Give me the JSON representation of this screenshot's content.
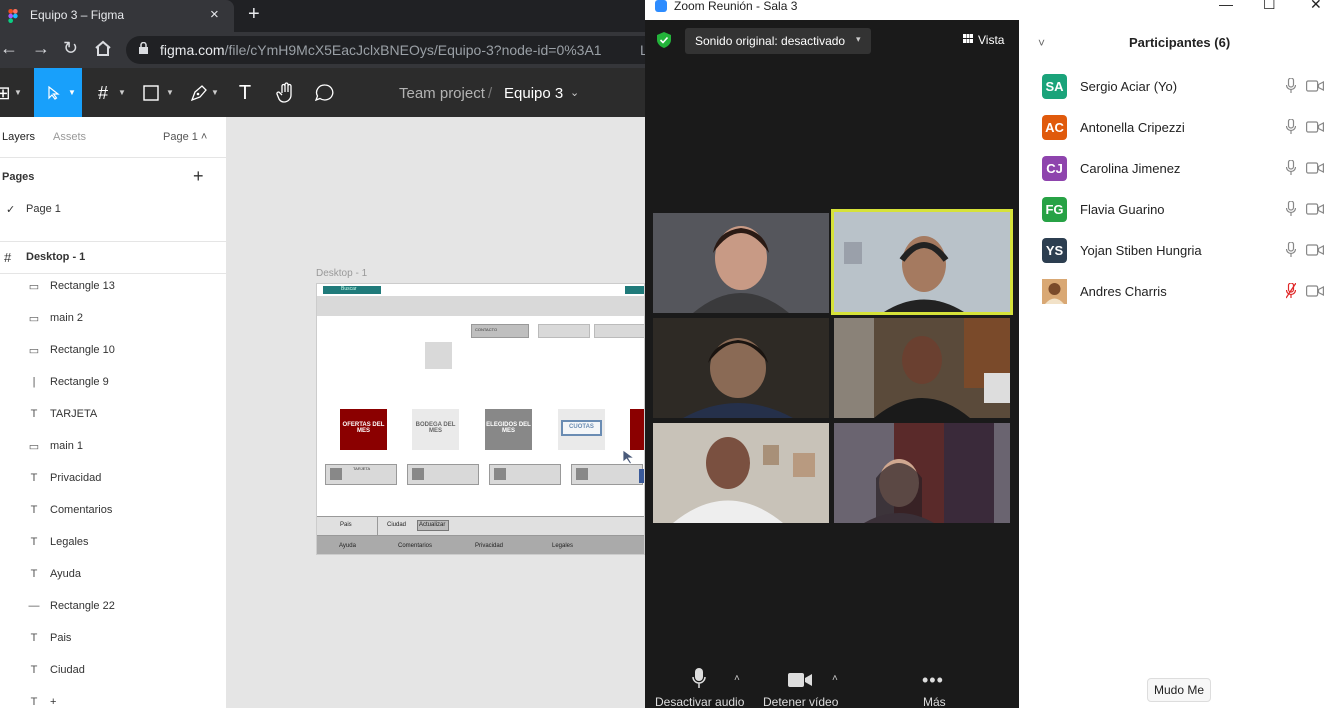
{
  "browser": {
    "tab_title": "Equipo 3 – Figma",
    "tab_close": "×",
    "new_tab": "+",
    "url_host": "figma.com",
    "url_path": "/file/cYmH9McX5EacJclxBNEOys/Equipo-3?node-id=0%3A1",
    "url_tail": "L"
  },
  "figma": {
    "breadcrumb_team": "Team project",
    "breadcrumb_sep": "/",
    "breadcrumb_file": "Equipo 3",
    "tabs": {
      "layers": "Layers",
      "assets": "Assets",
      "page": "Page 1 ˄"
    },
    "pages_header": "Pages",
    "pages_add": "+",
    "page_check": "✓",
    "page_name": "Page 1",
    "frame_label": "Desktop - 1",
    "layers": [
      {
        "icon": "rect",
        "label": "Rectangle 13"
      },
      {
        "icon": "rect",
        "label": "main 2"
      },
      {
        "icon": "rect",
        "label": "Rectangle 10"
      },
      {
        "icon": "vline",
        "label": "Rectangle 9"
      },
      {
        "icon": "text",
        "label": "TARJETA"
      },
      {
        "icon": "rect",
        "label": "main 1"
      },
      {
        "icon": "text",
        "label": "Privacidad"
      },
      {
        "icon": "text",
        "label": "Comentarios"
      },
      {
        "icon": "text",
        "label": "Legales"
      },
      {
        "icon": "text",
        "label": "Ayuda"
      },
      {
        "icon": "line",
        "label": "Rectangle 22"
      },
      {
        "icon": "text",
        "label": "Pais"
      },
      {
        "icon": "text",
        "label": "Ciudad"
      },
      {
        "icon": "text",
        "label": "+"
      }
    ],
    "canvas": {
      "frame_name": "Desktop - 1",
      "search_label": "Buscar",
      "contact_label": "CONTACTO",
      "cards": [
        "OFERTAS DEL MES",
        "BODEGA DEL MES",
        "ELEGIDOS DEL MES",
        "CUOTAS"
      ],
      "tarjeta_label": "TARJETA",
      "pais": "Pais",
      "ciudad": "Ciudad",
      "actualizar": "Actualizar",
      "footer": [
        "Ayuda",
        "Comentarios",
        "Privacidad",
        "Legales"
      ]
    }
  },
  "zoom": {
    "window_title": "Zoom Reunión - Sala 3",
    "win_min": "—",
    "win_max": "☐",
    "win_close": "✕",
    "sound_label": "Sonido original: desactivado",
    "sound_caret": "▾",
    "view_label": "Vista",
    "mic_label": "Desactivar audio",
    "cam_label": "Detener vídeo",
    "more_label": "Más",
    "more_icon": "•••",
    "caret_up": "˄"
  },
  "participants": {
    "collapse": "˅",
    "title": "Participantes (6)",
    "list": [
      {
        "initials": "SA",
        "name": "Sergio Aciar (Yo)",
        "color": "#1aa37a",
        "muted": false
      },
      {
        "initials": "AC",
        "name": "Antonella Cripezzi",
        "color": "#e05a0c",
        "muted": false
      },
      {
        "initials": "CJ",
        "name": "Carolina Jimenez",
        "color": "#8e44ad",
        "muted": false
      },
      {
        "initials": "FG",
        "name": "Flavia Guarino",
        "color": "#27a245",
        "muted": false
      },
      {
        "initials": "YS",
        "name": "Yojan Stiben Hungria",
        "color": "#2c3e50",
        "muted": false
      },
      {
        "initials": "",
        "name": "Andres Charris",
        "color": "#c08a55",
        "muted": true
      }
    ],
    "mute_me": "Mudo Me"
  }
}
